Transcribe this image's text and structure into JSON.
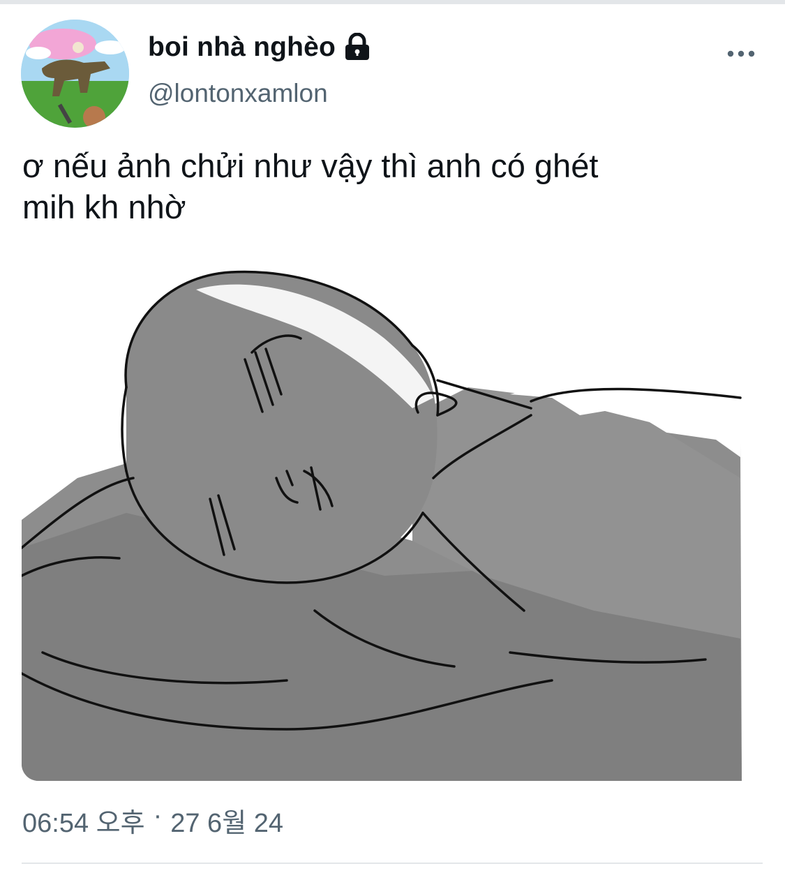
{
  "tweet": {
    "author": {
      "display_name": "boi nhà nghèo",
      "handle": "@lontonxamlon",
      "protected_icon": "lock-icon",
      "avatar_icon": "avatar"
    },
    "text": "ơ nếu ảnh chửi như vậy thì anh có ghét\nmih kh nhờ",
    "media_icon": "attached-image",
    "time": "06:54 오후",
    "separator": "·",
    "date": "27 6월 24",
    "more_icon": "more-horizontal-icon"
  },
  "colors": {
    "text_primary": "#0f1419",
    "text_secondary": "#536471",
    "divider": "#e3e6e9"
  }
}
